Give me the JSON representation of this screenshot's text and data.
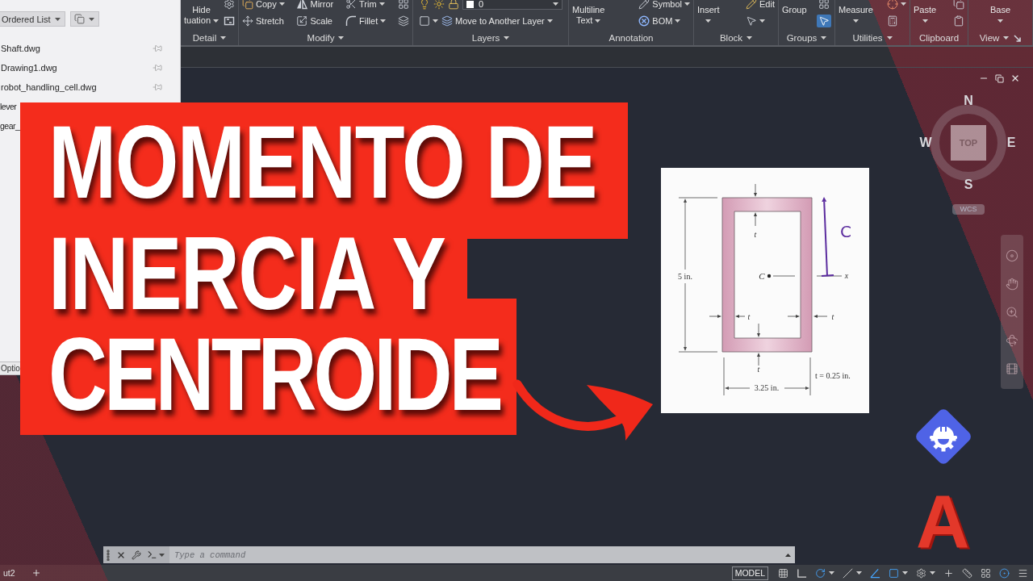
{
  "app_menu": {
    "sort_dropdown": "Ordered List",
    "documents": [
      {
        "name": "Shaft.dwg",
        "pin_shown": true
      },
      {
        "name": "Drawing1.dwg",
        "pin_shown": true
      },
      {
        "name": "robot_handling_cell.dwg",
        "pin_shown": true
      },
      {
        "name": "lever",
        "pin_shown": false
      },
      {
        "name": "gear_",
        "pin_shown": false
      }
    ],
    "options_button": "Optio"
  },
  "ribbon": {
    "panels": [
      {
        "title": "Detail",
        "menu": true,
        "launcher": false,
        "columns": [
          {
            "kind": "large",
            "lines": [
              "Hide",
              "tuation"
            ],
            "caret": true
          },
          {
            "kind": "stack",
            "items": [
              {
                "caret": false
              },
              {
                "caret": false
              }
            ]
          }
        ]
      },
      {
        "title": "Modify",
        "menu": true,
        "launcher": false,
        "columns": [
          {
            "kind": "stack",
            "items": [
              {
                "label": "Copy",
                "caret": true
              },
              {
                "label": "Stretch",
                "caret": false
              }
            ]
          },
          {
            "kind": "stack",
            "items": [
              {
                "label": "Mirror",
                "caret": false
              },
              {
                "label": "Scale",
                "caret": false
              }
            ]
          },
          {
            "kind": "stack",
            "items": [
              {
                "label": "Trim",
                "caret": true
              },
              {
                "label": "Fillet",
                "caret": true
              }
            ]
          },
          {
            "kind": "stack",
            "items": [
              {
                "caret": false
              },
              {
                "caret": false
              }
            ]
          }
        ]
      },
      {
        "title": "Layers",
        "menu": true,
        "launcher": false,
        "columns": [
          {
            "kind": "layer_stack",
            "layer": "0",
            "tool": "Move to Another Layer"
          }
        ]
      },
      {
        "title": "Annotation",
        "menu": false,
        "launcher": false,
        "columns": [
          {
            "kind": "large",
            "lines": [
              "Multiline",
              "Text"
            ],
            "caret": true
          },
          {
            "kind": "stack",
            "items": [
              {
                "label": "Symbol",
                "caret": true
              },
              {
                "label": "BOM",
                "caret": true
              }
            ]
          }
        ]
      },
      {
        "title": "Block",
        "menu": true,
        "launcher": false,
        "columns": [
          {
            "kind": "large",
            "lines": [
              "Insert"
            ],
            "caret": true
          },
          {
            "kind": "stack",
            "items": [
              {
                "label": "Edit",
                "caret": false
              },
              {
                "caret": true
              }
            ]
          }
        ]
      },
      {
        "title": "Groups",
        "menu": true,
        "launcher": false,
        "columns": [
          {
            "kind": "large",
            "lines": [
              "Group"
            ],
            "caret": false
          },
          {
            "kind": "stack",
            "items": [
              {
                "caret": false,
                "on": false
              },
              {
                "caret": false,
                "on": true
              }
            ]
          }
        ]
      },
      {
        "title": "Utilities",
        "menu": true,
        "launcher": false,
        "columns": [
          {
            "kind": "large",
            "lines": [
              "Measure"
            ],
            "caret": true
          },
          {
            "kind": "stack",
            "items": [
              {
                "caret": true
              },
              {
                "caret": false
              }
            ]
          }
        ]
      },
      {
        "title": "Clipboard",
        "menu": false,
        "launcher": false,
        "columns": [
          {
            "kind": "large",
            "lines": [
              "Paste"
            ],
            "caret": true
          },
          {
            "kind": "stack",
            "items": [
              {
                "caret": false
              },
              {
                "caret": false
              }
            ]
          }
        ]
      },
      {
        "title": "View",
        "menu": true,
        "launcher": true,
        "columns": [
          {
            "kind": "large",
            "lines": [
              "Base"
            ],
            "caret": true
          }
        ]
      }
    ]
  },
  "thumbnail": {
    "title_lines": [
      "MOMENTO DE",
      "INERCIA Y",
      "CENTROIDE"
    ],
    "logo_letter": "A"
  },
  "figure": {
    "height_label": "5 in.",
    "centroid_label": "C",
    "axis_label": "x",
    "thickness_labels": [
      "t",
      "t",
      "t",
      "t"
    ],
    "thickness_note": "t = 0.25 in.",
    "width_label": "3.25 in.",
    "handwritten_label": "C"
  },
  "view_cube": {
    "north": "N",
    "west": "W",
    "east": "E",
    "south": "S",
    "face": "TOP",
    "coordinate_system": "WCS"
  },
  "command_line": {
    "placeholder": "Type a command"
  },
  "status_bar": {
    "layout_tab": "ut2",
    "model_button": "MODEL",
    "tools": [
      {
        "on": false,
        "caret": false
      },
      {
        "on": false,
        "caret": false
      },
      {
        "on": true,
        "caret": true
      },
      {
        "on": false,
        "caret": true
      },
      {
        "on": true,
        "caret": false
      },
      {
        "on": true,
        "caret": true
      },
      {
        "on": false,
        "caret": true
      },
      {
        "on": false,
        "caret": false
      },
      {
        "on": false,
        "caret": false
      },
      {
        "on": false,
        "caret": false
      },
      {
        "on": true,
        "caret": false
      },
      {
        "on": false,
        "caret": false
      }
    ]
  }
}
